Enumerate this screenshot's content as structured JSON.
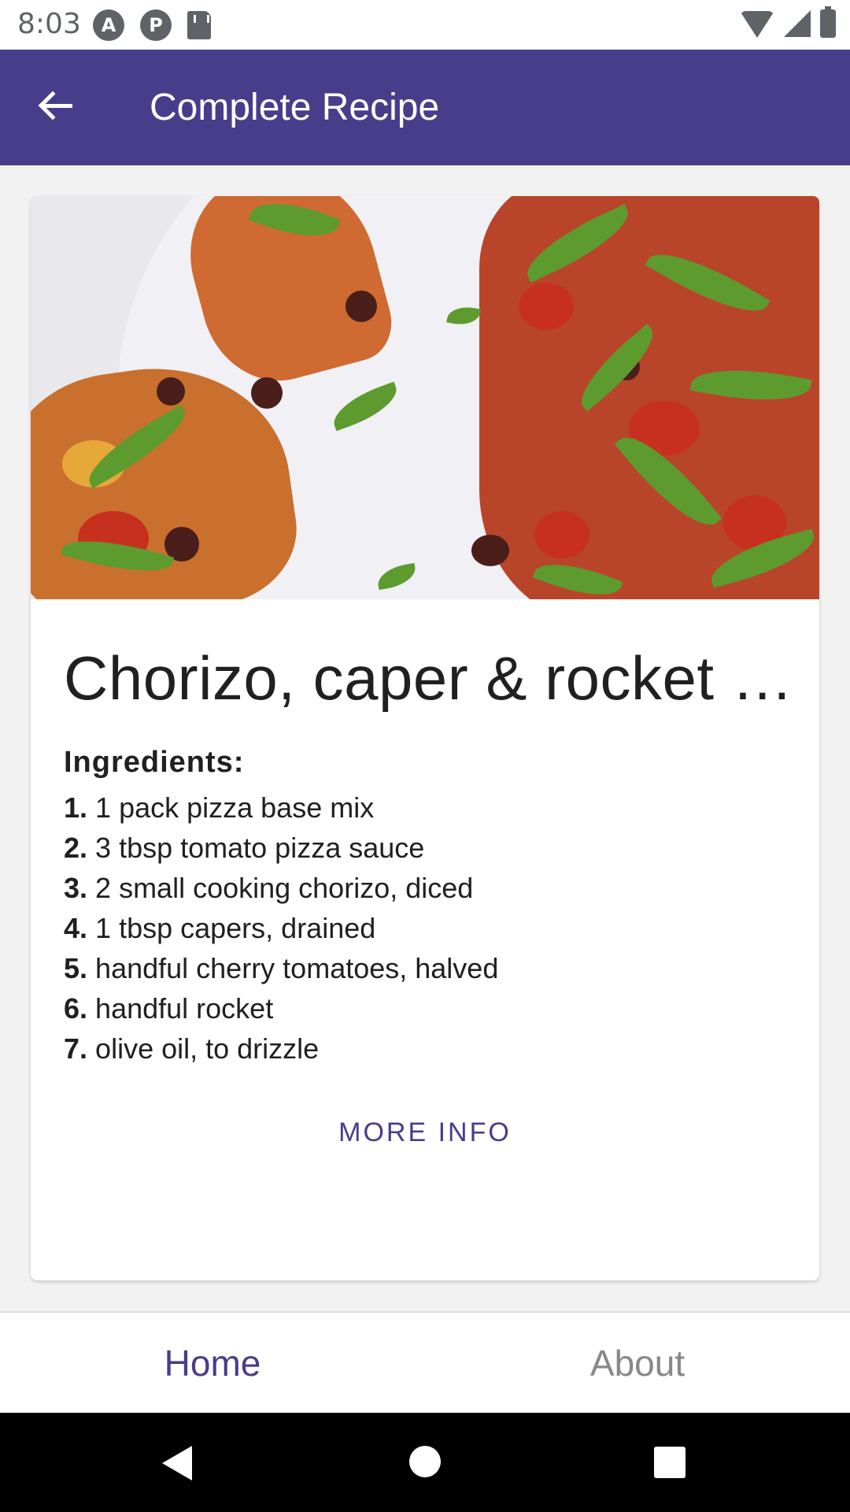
{
  "status_bar": {
    "time": "8:03",
    "left_icons": [
      "a-icon",
      "p-icon",
      "sd-card-icon"
    ],
    "left_icon_glyphs": [
      "A",
      "P"
    ],
    "right_icons": [
      "wifi-icon",
      "signal-icon",
      "battery-icon"
    ]
  },
  "app_bar": {
    "title": "Complete Recipe",
    "background": "#483d8b",
    "back_icon": "arrow-back-icon"
  },
  "recipe": {
    "title": "Chorizo, caper & rocket pi...",
    "ingredients_heading": "Ingredients:",
    "ingredients": [
      {
        "num": "1.",
        "text": "1 pack pizza base mix"
      },
      {
        "num": "2.",
        "text": "3 tbsp tomato pizza sauce"
      },
      {
        "num": "3.",
        "text": "2 small cooking chorizo, diced"
      },
      {
        "num": "4.",
        "text": "1 tbsp capers, drained"
      },
      {
        "num": "5.",
        "text": "handful cherry tomatoes, halved"
      },
      {
        "num": "6.",
        "text": "handful rocket"
      },
      {
        "num": "7.",
        "text": "olive oil, to drizzle"
      }
    ],
    "more_info_label": "MORE INFO"
  },
  "bottom_nav": {
    "tabs": [
      {
        "label": "Home",
        "active": true
      },
      {
        "label": "About",
        "active": false
      }
    ]
  },
  "system_nav": {
    "icons": [
      "nav-back-icon",
      "nav-home-icon",
      "nav-recents-icon"
    ]
  },
  "colors": {
    "accent": "#483d8b",
    "inactive_tab": "#888888"
  }
}
